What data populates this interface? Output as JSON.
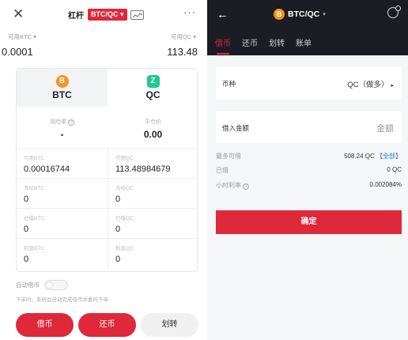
{
  "left": {
    "header": {
      "title": "杠杆",
      "pair_badge": "BTC/QC ▾",
      "more": "···"
    },
    "available": {
      "btc_label": "可用BTC ▾",
      "btc_value": "0.0001",
      "qc_label": "可用QC ▾",
      "qc_value": "113.48"
    },
    "card": {
      "tabs": [
        {
          "icon": "B",
          "name": "BTC"
        },
        {
          "icon": "Z",
          "name": "QC"
        }
      ],
      "risk_label": "风险率",
      "risk_value": "-",
      "close_label": "平仓价",
      "close_value": "0.00",
      "rows": [
        [
          {
            "label": "可用BTC",
            "value": "0.00016744"
          },
          {
            "label": "可用QC",
            "value": "113.48984679"
          }
        ],
        [
          {
            "label": "冻结BTC",
            "value": "0"
          },
          {
            "label": "冻结QC",
            "value": "0"
          }
        ],
        [
          {
            "label": "已借BTC",
            "value": "0"
          },
          {
            "label": "已借QC",
            "value": "0"
          }
        ],
        [
          {
            "label": "利息BTC",
            "value": "0"
          },
          {
            "label": "利息QC",
            "value": "0"
          }
        ]
      ]
    },
    "auto_borrow": {
      "label": "自动借币",
      "desc": "下单时，系统会自动完成借币并委托下单"
    },
    "buttons": {
      "borrow": "借币",
      "repay": "还币",
      "transfer": "划转"
    }
  },
  "right": {
    "header": {
      "coin_icon": "B",
      "pair": "BTC/QC",
      "caret": "▾"
    },
    "tabs": [
      "借币",
      "还币",
      "划转",
      "账单"
    ],
    "currency_label": "币种",
    "currency_value": "QC（做多）",
    "amount_label": "借入金额",
    "amount_placeholder": "金额",
    "max_label": "最多可借",
    "max_value": "508.24 QC",
    "max_all": "【全部】",
    "borrowed_label": "已借",
    "borrowed_value": "0 QC",
    "rate_label": "小时利率",
    "rate_value": "0.002084%",
    "confirm": "确定"
  },
  "colors": {
    "accent_red": "#e0283b",
    "dark_header": "#1b1c24",
    "link_blue": "#2b73e4",
    "btc_orange": "#f7931a",
    "qc_green": "#1ec98e"
  }
}
